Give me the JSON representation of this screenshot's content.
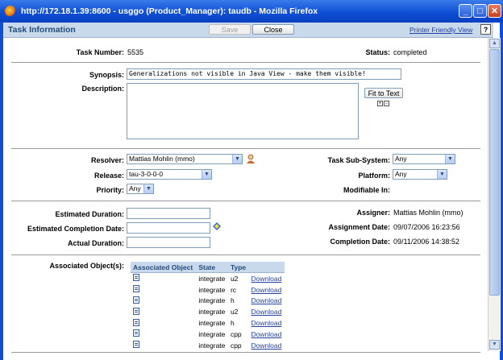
{
  "window": {
    "title": "http://172.18.1.39:8600 - usggo (Product_Manager): taudb - Mozilla Firefox"
  },
  "header": {
    "title": "Task Information",
    "save_label": "Save",
    "close_label": "Close",
    "printer_link": "Printer Friendly View",
    "help_label": "?"
  },
  "task": {
    "number_label": "Task Number:",
    "number": "5535",
    "status_label": "Status:",
    "status": "completed",
    "synopsis_label": "Synopsis:",
    "synopsis": "Generalizations not visible in Java View - make them visible!",
    "description_label": "Description:",
    "description": "",
    "fit_to_text": "Fit to Text",
    "expand": "+",
    "collapse": "−"
  },
  "assignment": {
    "resolver_label": "Resolver:",
    "resolver": "Mattias Mohlin (mmo)",
    "subsystem_label": "Task Sub-System:",
    "subsystem": "Any",
    "release_label": "Release:",
    "release": "tau-3-0-0-0",
    "platform_label": "Platform:",
    "platform": "Any",
    "priority_label": "Priority:",
    "priority": "Any",
    "modifiable_label": "Modifiable In:",
    "modifiable": ""
  },
  "schedule": {
    "est_duration_label": "Estimated Duration:",
    "est_duration": "",
    "est_completion_label": "Estimated Completion Date:",
    "est_completion": "",
    "actual_duration_label": "Actual Duration:",
    "actual_duration": "",
    "assigner_label": "Assigner:",
    "assigner": "Mattias Mohlin (mmo)",
    "assignment_date_label": "Assignment Date:",
    "assignment_date": "09/07/2006 16:23:56",
    "completion_date_label": "Completion Date:",
    "completion_date": "09/11/2006 14:38:52"
  },
  "objects": {
    "label": "Associated Object(s):",
    "columns": [
      "Associated Object",
      "State",
      "Type",
      ""
    ],
    "rows": [
      {
        "state": "integrate",
        "type": "u2",
        "link": "Download"
      },
      {
        "state": "integrate",
        "type": "rc",
        "link": "Download"
      },
      {
        "state": "integrate",
        "type": "h",
        "link": "Download"
      },
      {
        "state": "integrate",
        "type": "u2",
        "link": "Download"
      },
      {
        "state": "integrate",
        "type": "h",
        "link": "Download"
      },
      {
        "state": "integrate",
        "type": "cpp",
        "link": "Download"
      },
      {
        "state": "integrate",
        "type": "cpp",
        "link": "Download"
      }
    ]
  }
}
